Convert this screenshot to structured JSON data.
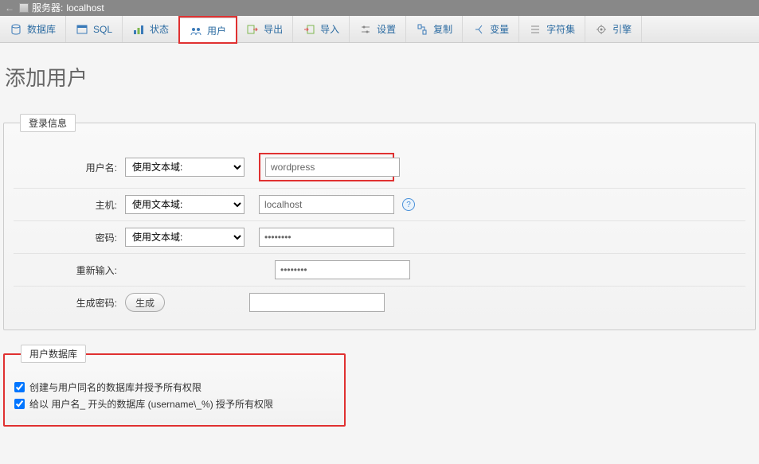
{
  "server_bar": {
    "prefix": "服务器:",
    "host": "localhost"
  },
  "tabs": {
    "database": "数据库",
    "sql": "SQL",
    "status": "状态",
    "users": "用户",
    "export": "导出",
    "import": "导入",
    "settings": "设置",
    "replication": "复制",
    "variables": "变量",
    "charsets": "字符集",
    "engines": "引擎"
  },
  "page_title": "添加用户",
  "login_info": {
    "legend": "登录信息",
    "username_label": "用户名:",
    "username_select": "使用文本域:",
    "username_value": "wordpress",
    "host_label": "主机:",
    "host_select": "使用文本域:",
    "host_value": "localhost",
    "password_label": "密码:",
    "password_select": "使用文本域:",
    "password_value": "••••••••",
    "password2_label": "重新输入:",
    "password2_value": "••••••••",
    "genpass_label": "生成密码:",
    "genpass_button": "生成"
  },
  "user_db": {
    "legend": "用户数据库",
    "opt_create_same": "创建与用户同名的数据库并授予所有权限",
    "opt_prefix": "给以 用户名_ 开头的数据库 (username\\_%) 授予所有权限"
  }
}
